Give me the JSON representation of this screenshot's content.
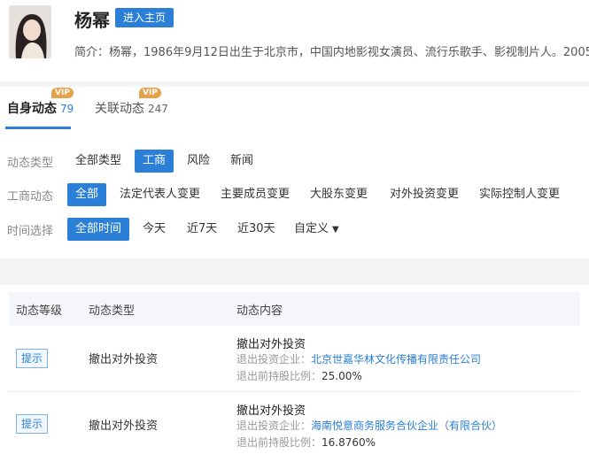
{
  "profile": {
    "name": "杨幂",
    "home_button": "进入主页",
    "intro": "简介：杨幂，1986年9月12日出生于北京市，中国内地影视女演员、流行乐歌手、影视制片人。2005"
  },
  "tabs": [
    {
      "label": "自身动态",
      "count": "79",
      "badge": "VIP",
      "active": true
    },
    {
      "label": "关联动态",
      "count": "247",
      "badge": "VIP",
      "active": false
    }
  ],
  "filters": {
    "type": {
      "label": "动态类型",
      "options": [
        "全部类型",
        "工商",
        "风险",
        "新闻"
      ],
      "selected": "工商"
    },
    "business": {
      "label": "工商动态",
      "options": [
        "全部",
        "法定代表人变更",
        "主要成员变更",
        "大股东变更",
        "对外投资变更",
        "实际控制人变更"
      ],
      "selected": "全部"
    },
    "time": {
      "label": "时间选择",
      "options": [
        "全部时间",
        "今天",
        "近7天",
        "近30天",
        "自定义"
      ],
      "selected": "全部时间"
    }
  },
  "table": {
    "headers": [
      "动态等级",
      "动态类型",
      "动态内容"
    ],
    "rows": [
      {
        "level": "提示",
        "type": "撤出对外投资",
        "title": "撤出对外投资",
        "company_label": "退出投资企业：",
        "company": "北京世嘉华林文化传播有限责任公司",
        "ratio_label": "退出前持股比例：",
        "ratio": "25.00%"
      },
      {
        "level": "提示",
        "type": "撤出对外投资",
        "title": "撤出对外投资",
        "company_label": "退出投资企业：",
        "company": "海南悦意商务服务合伙企业（有限合伙）",
        "ratio_label": "退出前持股比例：",
        "ratio": "16.8760%"
      }
    ]
  },
  "colors": {
    "accent": "#2b7fd6",
    "vip": "#e7a14a",
    "gap": "#f4f5f7"
  },
  "icons": {
    "avatar": "avatar-photo",
    "dropdown": "caret-down-icon"
  }
}
